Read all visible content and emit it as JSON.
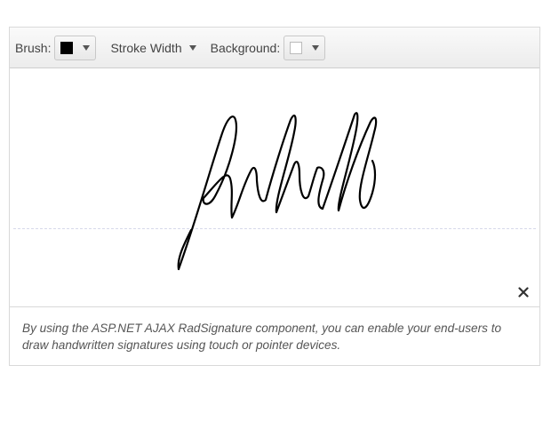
{
  "toolbar": {
    "brush_label": "Brush:",
    "brush_color": "#000000",
    "stroke_width_label": "Stroke Width",
    "background_label": "Background:",
    "background_color": "#ffffff"
  },
  "canvas": {
    "signature_color": "#000000",
    "clear_icon": "close-icon"
  },
  "description": {
    "text": "By using the ASP.NET AJAX RadSignature component, you can enable your end-users to draw handwritten signatures using touch or pointer devices."
  }
}
